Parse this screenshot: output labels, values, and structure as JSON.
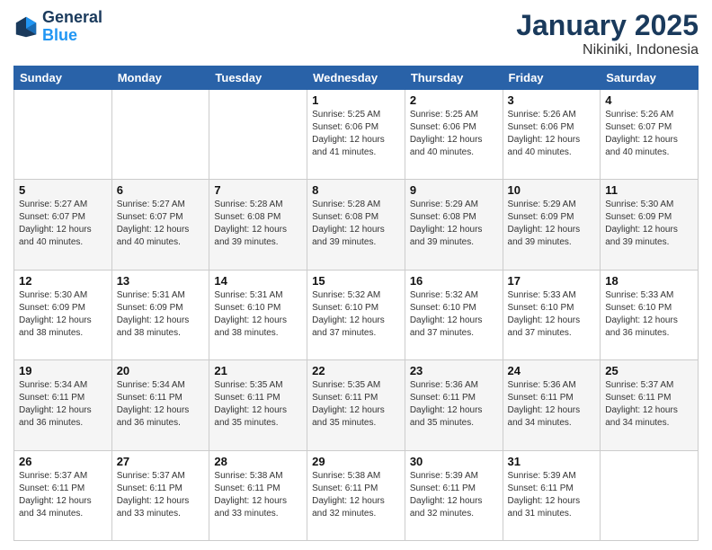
{
  "logo": {
    "line1": "General",
    "line2": "Blue"
  },
  "title": "January 2025",
  "location": "Nikiniki, Indonesia",
  "days_header": [
    "Sunday",
    "Monday",
    "Tuesday",
    "Wednesday",
    "Thursday",
    "Friday",
    "Saturday"
  ],
  "weeks": [
    [
      {
        "day": "",
        "sunrise": "",
        "sunset": "",
        "daylight": ""
      },
      {
        "day": "",
        "sunrise": "",
        "sunset": "",
        "daylight": ""
      },
      {
        "day": "",
        "sunrise": "",
        "sunset": "",
        "daylight": ""
      },
      {
        "day": "1",
        "sunrise": "Sunrise: 5:25 AM",
        "sunset": "Sunset: 6:06 PM",
        "daylight": "Daylight: 12 hours and 41 minutes."
      },
      {
        "day": "2",
        "sunrise": "Sunrise: 5:25 AM",
        "sunset": "Sunset: 6:06 PM",
        "daylight": "Daylight: 12 hours and 40 minutes."
      },
      {
        "day": "3",
        "sunrise": "Sunrise: 5:26 AM",
        "sunset": "Sunset: 6:06 PM",
        "daylight": "Daylight: 12 hours and 40 minutes."
      },
      {
        "day": "4",
        "sunrise": "Sunrise: 5:26 AM",
        "sunset": "Sunset: 6:07 PM",
        "daylight": "Daylight: 12 hours and 40 minutes."
      }
    ],
    [
      {
        "day": "5",
        "sunrise": "Sunrise: 5:27 AM",
        "sunset": "Sunset: 6:07 PM",
        "daylight": "Daylight: 12 hours and 40 minutes."
      },
      {
        "day": "6",
        "sunrise": "Sunrise: 5:27 AM",
        "sunset": "Sunset: 6:07 PM",
        "daylight": "Daylight: 12 hours and 40 minutes."
      },
      {
        "day": "7",
        "sunrise": "Sunrise: 5:28 AM",
        "sunset": "Sunset: 6:08 PM",
        "daylight": "Daylight: 12 hours and 39 minutes."
      },
      {
        "day": "8",
        "sunrise": "Sunrise: 5:28 AM",
        "sunset": "Sunset: 6:08 PM",
        "daylight": "Daylight: 12 hours and 39 minutes."
      },
      {
        "day": "9",
        "sunrise": "Sunrise: 5:29 AM",
        "sunset": "Sunset: 6:08 PM",
        "daylight": "Daylight: 12 hours and 39 minutes."
      },
      {
        "day": "10",
        "sunrise": "Sunrise: 5:29 AM",
        "sunset": "Sunset: 6:09 PM",
        "daylight": "Daylight: 12 hours and 39 minutes."
      },
      {
        "day": "11",
        "sunrise": "Sunrise: 5:30 AM",
        "sunset": "Sunset: 6:09 PM",
        "daylight": "Daylight: 12 hours and 39 minutes."
      }
    ],
    [
      {
        "day": "12",
        "sunrise": "Sunrise: 5:30 AM",
        "sunset": "Sunset: 6:09 PM",
        "daylight": "Daylight: 12 hours and 38 minutes."
      },
      {
        "day": "13",
        "sunrise": "Sunrise: 5:31 AM",
        "sunset": "Sunset: 6:09 PM",
        "daylight": "Daylight: 12 hours and 38 minutes."
      },
      {
        "day": "14",
        "sunrise": "Sunrise: 5:31 AM",
        "sunset": "Sunset: 6:10 PM",
        "daylight": "Daylight: 12 hours and 38 minutes."
      },
      {
        "day": "15",
        "sunrise": "Sunrise: 5:32 AM",
        "sunset": "Sunset: 6:10 PM",
        "daylight": "Daylight: 12 hours and 37 minutes."
      },
      {
        "day": "16",
        "sunrise": "Sunrise: 5:32 AM",
        "sunset": "Sunset: 6:10 PM",
        "daylight": "Daylight: 12 hours and 37 minutes."
      },
      {
        "day": "17",
        "sunrise": "Sunrise: 5:33 AM",
        "sunset": "Sunset: 6:10 PM",
        "daylight": "Daylight: 12 hours and 37 minutes."
      },
      {
        "day": "18",
        "sunrise": "Sunrise: 5:33 AM",
        "sunset": "Sunset: 6:10 PM",
        "daylight": "Daylight: 12 hours and 36 minutes."
      }
    ],
    [
      {
        "day": "19",
        "sunrise": "Sunrise: 5:34 AM",
        "sunset": "Sunset: 6:11 PM",
        "daylight": "Daylight: 12 hours and 36 minutes."
      },
      {
        "day": "20",
        "sunrise": "Sunrise: 5:34 AM",
        "sunset": "Sunset: 6:11 PM",
        "daylight": "Daylight: 12 hours and 36 minutes."
      },
      {
        "day": "21",
        "sunrise": "Sunrise: 5:35 AM",
        "sunset": "Sunset: 6:11 PM",
        "daylight": "Daylight: 12 hours and 35 minutes."
      },
      {
        "day": "22",
        "sunrise": "Sunrise: 5:35 AM",
        "sunset": "Sunset: 6:11 PM",
        "daylight": "Daylight: 12 hours and 35 minutes."
      },
      {
        "day": "23",
        "sunrise": "Sunrise: 5:36 AM",
        "sunset": "Sunset: 6:11 PM",
        "daylight": "Daylight: 12 hours and 35 minutes."
      },
      {
        "day": "24",
        "sunrise": "Sunrise: 5:36 AM",
        "sunset": "Sunset: 6:11 PM",
        "daylight": "Daylight: 12 hours and 34 minutes."
      },
      {
        "day": "25",
        "sunrise": "Sunrise: 5:37 AM",
        "sunset": "Sunset: 6:11 PM",
        "daylight": "Daylight: 12 hours and 34 minutes."
      }
    ],
    [
      {
        "day": "26",
        "sunrise": "Sunrise: 5:37 AM",
        "sunset": "Sunset: 6:11 PM",
        "daylight": "Daylight: 12 hours and 34 minutes."
      },
      {
        "day": "27",
        "sunrise": "Sunrise: 5:37 AM",
        "sunset": "Sunset: 6:11 PM",
        "daylight": "Daylight: 12 hours and 33 minutes."
      },
      {
        "day": "28",
        "sunrise": "Sunrise: 5:38 AM",
        "sunset": "Sunset: 6:11 PM",
        "daylight": "Daylight: 12 hours and 33 minutes."
      },
      {
        "day": "29",
        "sunrise": "Sunrise: 5:38 AM",
        "sunset": "Sunset: 6:11 PM",
        "daylight": "Daylight: 12 hours and 32 minutes."
      },
      {
        "day": "30",
        "sunrise": "Sunrise: 5:39 AM",
        "sunset": "Sunset: 6:11 PM",
        "daylight": "Daylight: 12 hours and 32 minutes."
      },
      {
        "day": "31",
        "sunrise": "Sunrise: 5:39 AM",
        "sunset": "Sunset: 6:11 PM",
        "daylight": "Daylight: 12 hours and 31 minutes."
      },
      {
        "day": "",
        "sunrise": "",
        "sunset": "",
        "daylight": ""
      }
    ]
  ]
}
